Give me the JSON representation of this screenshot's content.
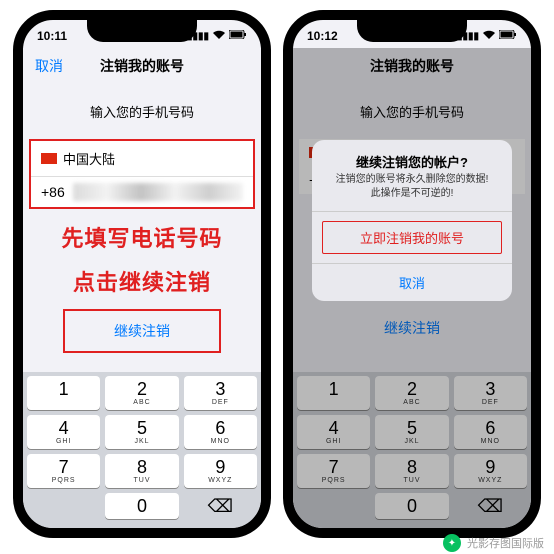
{
  "status": {
    "time_left": "10:11",
    "time_right": "10:12",
    "signal": "▪▪▪▪",
    "wifi": "◉",
    "battery": "▮"
  },
  "nav": {
    "cancel": "取消",
    "title": "注销我的账号"
  },
  "page": {
    "subtitle": "输入您的手机号码",
    "country": "中国大陆",
    "code": "+86",
    "continue": "继续注销"
  },
  "annot": {
    "line1": "先填写电话号码",
    "line2": "点击继续注销"
  },
  "alert": {
    "title": "继续注销您的帐户?",
    "msg1": "注销您的账号将永久删除您的数据!",
    "msg2": "此操作是不可逆的!",
    "confirm": "立即注销我的账号",
    "cancel": "取消"
  },
  "keys": {
    "k1": "1",
    "s1": "",
    "k2": "2",
    "s2": "ABC",
    "k3": "3",
    "s3": "DEF",
    "k4": "4",
    "s4": "GHI",
    "k5": "5",
    "s5": "JKL",
    "k6": "6",
    "s6": "MNO",
    "k7": "7",
    "s7": "PQRS",
    "k8": "8",
    "s8": "TUV",
    "k9": "9",
    "s9": "WXYZ",
    "k0": "0",
    "del": "⌫"
  },
  "footer": {
    "name": "光影存图国际版"
  }
}
